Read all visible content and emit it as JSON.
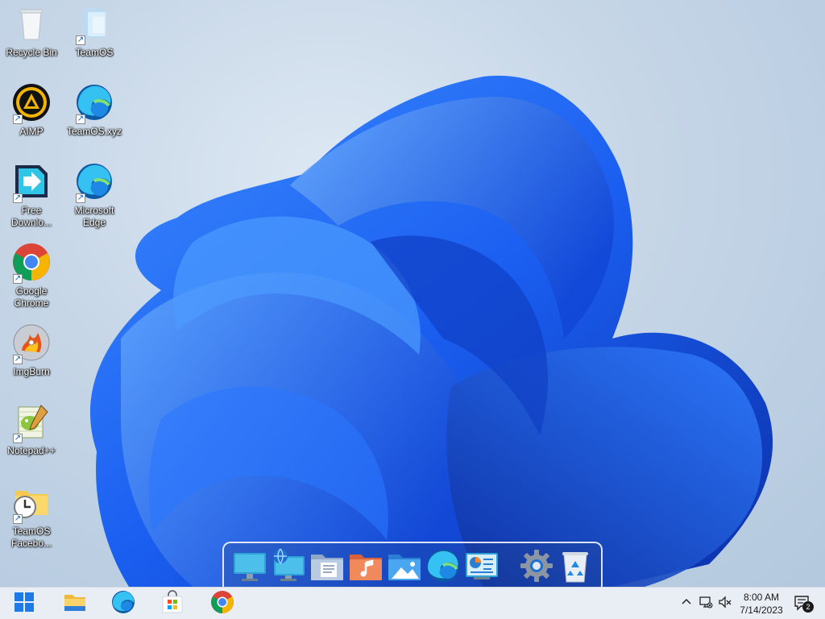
{
  "desktop": {
    "icons": [
      {
        "label": "Recycle Bin",
        "icon": "recycle-bin-icon",
        "shortcut": false
      },
      {
        "label": "TeamOS",
        "icon": "folder-icon",
        "shortcut": true
      },
      {
        "label": "AIMP",
        "icon": "aimp-icon",
        "shortcut": true
      },
      {
        "label": "TeamOS.xyz",
        "icon": "edge-icon",
        "shortcut": true
      },
      {
        "label": "Free Downlo...",
        "icon": "free-download-manager-icon",
        "shortcut": true
      },
      {
        "label": "Microsoft Edge",
        "icon": "edge-icon",
        "shortcut": true
      },
      {
        "label": "Google Chrome",
        "icon": "chrome-icon",
        "shortcut": true
      },
      {
        "label": "ImgBurn",
        "icon": "imgburn-icon",
        "shortcut": true
      },
      {
        "label": "Notepad++",
        "icon": "notepadpp-icon",
        "shortcut": true
      },
      {
        "label": "TeamOS Facebo...",
        "icon": "folder-clock-icon",
        "shortcut": true
      }
    ]
  },
  "dock": {
    "items": [
      {
        "icon": "desktop-monitor-icon"
      },
      {
        "icon": "network-globe-icon"
      },
      {
        "icon": "documents-folder-icon"
      },
      {
        "icon": "music-folder-icon"
      },
      {
        "icon": "pictures-folder-icon"
      },
      {
        "icon": "edge-icon"
      },
      {
        "icon": "control-panel-icon"
      },
      {
        "icon": "settings-gear-icon"
      },
      {
        "icon": "recycle-bin-icon"
      }
    ]
  },
  "taskbar": {
    "pinned": [
      {
        "icon": "start-windows-icon"
      },
      {
        "icon": "file-explorer-icon"
      },
      {
        "icon": "edge-icon"
      },
      {
        "icon": "microsoft-store-icon"
      },
      {
        "icon": "chrome-icon"
      }
    ],
    "tray": {
      "icons": [
        "chevron-up-icon",
        "network-icon",
        "volume-muted-icon"
      ],
      "time": "8:00 AM",
      "date": "7/14/2023",
      "notification_count": "2"
    }
  },
  "colors": {
    "accent": "#1e6cf0",
    "taskbar_bg": "#e9eef5",
    "wallpaper_bg": "#c6d6e7"
  }
}
